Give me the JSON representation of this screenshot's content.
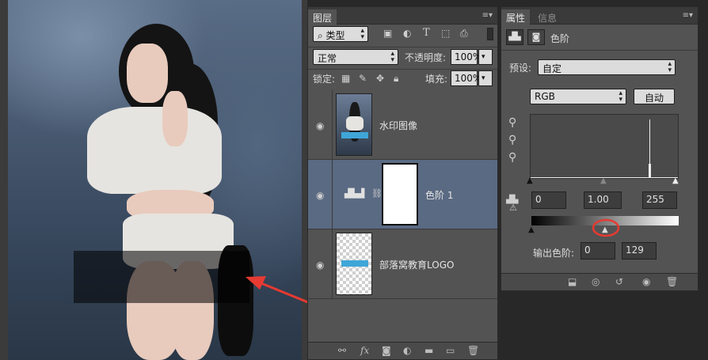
{
  "layers_panel": {
    "tab": "图层",
    "filter_kind": "类型",
    "blend_mode": "正常",
    "opacity_label": "不透明度:",
    "opacity_value": "100%",
    "lock_label": "锁定:",
    "fill_label": "填充:",
    "fill_value": "100%",
    "layers": [
      {
        "name": "水印图像",
        "icon": "photo-thumbnail"
      },
      {
        "name": "色阶 1",
        "icon": "levels-adjustment-icon"
      },
      {
        "name": "部落窝教育LOGO",
        "icon": "logo-thumbnail"
      }
    ],
    "bottom_icons": [
      "link-icon",
      "fx-icon",
      "mask-icon",
      "adjustment-icon",
      "folder-icon",
      "new-layer-icon",
      "trash-icon"
    ]
  },
  "properties_panel": {
    "tabs": [
      "属性",
      "信息"
    ],
    "adjustment_title": "色阶",
    "preset_label": "预设:",
    "preset_value": "自定",
    "channel_value": "RGB",
    "auto_button": "自动",
    "input_black": "0",
    "input_gamma": "1.00",
    "input_white": "255",
    "output_label": "输出色阶:",
    "output_black": "0",
    "output_white": "129",
    "bottom_icons": [
      "clip-icon",
      "view-previous-icon",
      "reset-icon",
      "visibility-icon",
      "trash-icon"
    ]
  },
  "colors": {
    "panel_bg": "#535353",
    "selected_layer": "#5a6a82",
    "annotation_red": "#e63a32"
  }
}
